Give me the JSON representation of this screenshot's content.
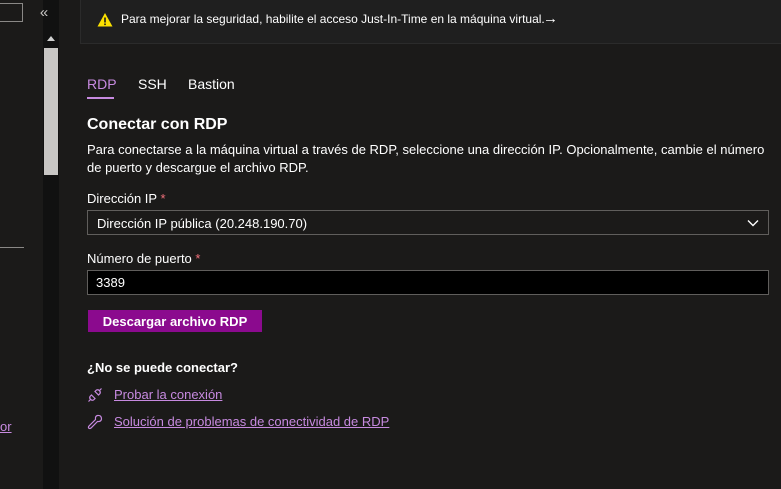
{
  "banner": {
    "message": "Para mejorar la seguridad, habilite el acceso Just-In-Time en la máquina virtual.",
    "arrow": "→",
    "icon": "warning-icon",
    "icon_color": "#fce100"
  },
  "sidebar": {
    "collapse_glyph": "«",
    "link_fragment": "or"
  },
  "tabs": [
    {
      "label": "RDP",
      "active": true
    },
    {
      "label": "SSH",
      "active": false
    },
    {
      "label": "Bastion",
      "active": false
    }
  ],
  "section": {
    "title": "Conectar con RDP",
    "description": "Para conectarse a la máquina virtual a través de RDP, seleccione una dirección IP. Opcionalmente, cambie el número de puerto y descargue el archivo RDP."
  },
  "form": {
    "ip_label": "Dirección IP",
    "ip_value": "Dirección IP pública (20.248.190.70)",
    "port_label": "Número de puerto",
    "port_value": "3389",
    "required_mark": "*"
  },
  "download_button": "Descargar archivo RDP",
  "troubleshoot": {
    "heading": "¿No se puede conectar?",
    "links": [
      {
        "label": "Probar la conexión",
        "icon": "plug-icon"
      },
      {
        "label": "Solución de problemas de conectividad de RDP",
        "icon": "wrench-icon"
      }
    ]
  },
  "colors": {
    "accent": "#c78ae0",
    "primary_button": "#8b0a8e",
    "required": "#f1707b",
    "background": "#1b1a19"
  }
}
